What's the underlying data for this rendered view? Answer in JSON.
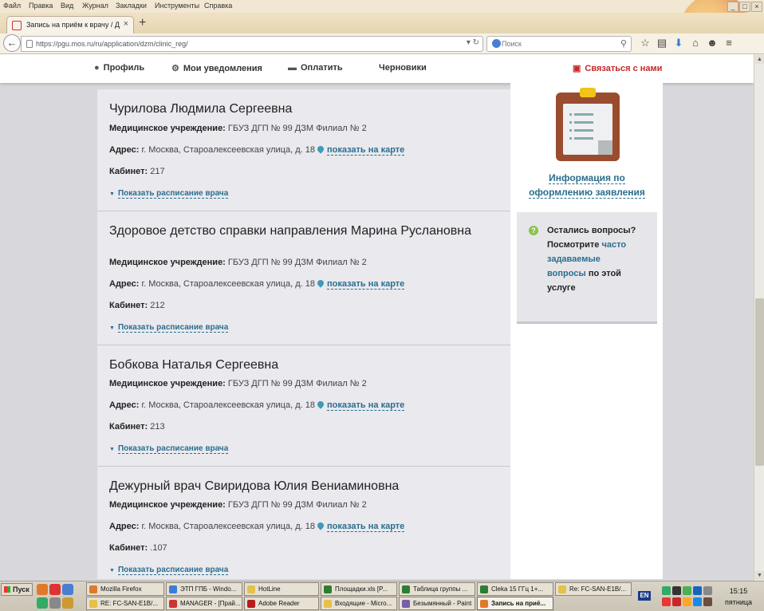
{
  "menubar": {
    "items": [
      "Файл",
      "Правка",
      "Вид",
      "Журнал",
      "Закладки",
      "Инструменты",
      "Справка"
    ]
  },
  "browser": {
    "tab_title": "Запись на приём к врачу / Д...",
    "url": "https://pgu.mos.ru/ru/application/dzm/clinic_reg/",
    "search_placeholder": "Поиск"
  },
  "site_nav": {
    "profile": "Профиль",
    "notifications": "Мои уведомления",
    "pay": "Оплатить",
    "drafts": "Черновики",
    "contact": "Связаться с нами"
  },
  "doctors": [
    {
      "name": "Чурилова Людмила Сергеевна",
      "institution_label": "Медицинское учреждение:",
      "institution": "ГБУЗ ДГП № 99 ДЗМ Филиал № 2",
      "address_label": "Адрес:",
      "address": "г. Москва, Староалексеевская улица, д. 18",
      "map_link": "показать на карте",
      "room_label": "Кабинет:",
      "room": "217",
      "schedule_link": "Показать расписание врача"
    },
    {
      "name": "Здоровое детство справки направления Марина Руслановна",
      "institution_label": "Медицинское учреждение:",
      "institution": "ГБУЗ ДГП № 99 ДЗМ Филиал № 2",
      "address_label": "Адрес:",
      "address": "г. Москва, Староалексеевская улица, д. 18",
      "map_link": "показать на карте",
      "room_label": "Кабинет:",
      "room": "212",
      "schedule_link": "Показать расписание врача"
    },
    {
      "name": "Бобкова Наталья Сергеевна",
      "institution_label": "Медицинское учреждение:",
      "institution": "ГБУЗ ДГП № 99 ДЗМ Филиал № 2",
      "address_label": "Адрес:",
      "address": "г. Москва, Староалексеевская улица, д. 18",
      "map_link": "показать на карте",
      "room_label": "Кабинет:",
      "room": "213",
      "schedule_link": "Показать расписание врача"
    },
    {
      "name": "Дежурный врач Свиридова Юлия Вениаминовна",
      "institution_label": "Медицинское учреждение:",
      "institution": "ГБУЗ ДГП № 99 ДЗМ Филиал № 2",
      "address_label": "Адрес:",
      "address": "г. Москва, Староалексеевская улица, д. 18",
      "map_link": "показать на карте",
      "room_label": "Кабинет:",
      "room": ".107",
      "schedule_link": "Показать расписание врача"
    }
  ],
  "sidebar": {
    "info_link_line1": "Информация по",
    "info_link_line2": "оформлению заявления",
    "faq": {
      "part1": "Остались вопросы? Посмотрите",
      "link": "часто задаваемые вопросы",
      "part2": "по этой услуге"
    }
  },
  "taskbar": {
    "start": "Пуск",
    "tasks_row1": [
      "Mozilla Firefox",
      "ЭТП ГПБ - Windo...",
      "HotLine",
      "Площадки.xls [P...",
      "Таблица группы ...",
      "Сleka 15 ГГц 1+...",
      "Re: FC-SAN-E1B/..."
    ],
    "tasks_row2": [
      "RE: FC-SAN-E1B/...",
      "MANAGER - [Прай...",
      "Adobe Reader",
      "Входящие - Micro...",
      "Безымянный - Paint",
      "Запись на приё..."
    ],
    "lang": "EN",
    "time": "15:15",
    "day": "пятница"
  },
  "colors": {
    "accent_link": "#2a6e8e",
    "contact_red": "#c62828",
    "clipboard": "#9a4c2f"
  }
}
